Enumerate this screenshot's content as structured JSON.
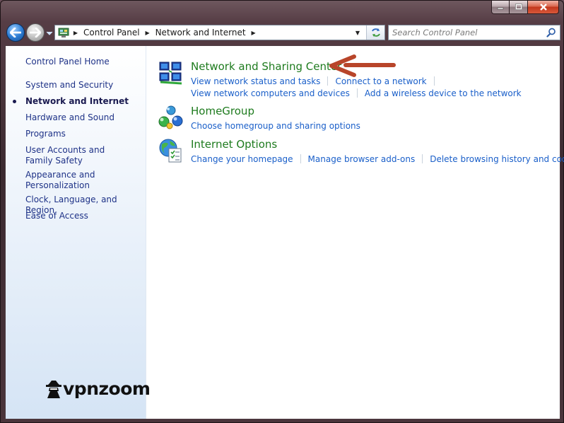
{
  "window": {
    "colors": {
      "frame": "#4a343b",
      "link": "#1a5fc9",
      "category_title": "#1e7b1e",
      "sidebar_text": "#1e3287",
      "arrow": "#b8452a"
    }
  },
  "address_bar": {
    "breadcrumbs": [
      "Control Panel",
      "Network and Internet"
    ]
  },
  "search": {
    "placeholder": "Search Control Panel"
  },
  "sidebar": {
    "home": "Control Panel Home",
    "items": [
      {
        "label": "System and Security",
        "active": false
      },
      {
        "label": "Network and Internet",
        "active": true
      },
      {
        "label": "Hardware and Sound",
        "active": false
      },
      {
        "label": "Programs",
        "active": false
      },
      {
        "label": "User Accounts and Family Safety",
        "active": false
      },
      {
        "label": "Appearance and Personalization",
        "active": false
      },
      {
        "label": "Clock, Language, and Region",
        "active": false
      },
      {
        "label": "Ease of Access",
        "active": false
      }
    ]
  },
  "categories": [
    {
      "title": "Network and Sharing Center",
      "icon": "network-sharing-icon",
      "links": [
        [
          "View network status and tasks",
          "Connect to a network"
        ],
        [
          "View network computers and devices",
          "Add a wireless device to the network"
        ]
      ]
    },
    {
      "title": "HomeGroup",
      "icon": "homegroup-icon",
      "links": [
        [
          "Choose homegroup and sharing options"
        ]
      ]
    },
    {
      "title": "Internet Options",
      "icon": "internet-options-icon",
      "links": [
        [
          "Change your homepage",
          "Manage browser add-ons",
          "Delete browsing history and cookies"
        ]
      ]
    }
  ],
  "watermark": {
    "text": "vpnzoom"
  }
}
